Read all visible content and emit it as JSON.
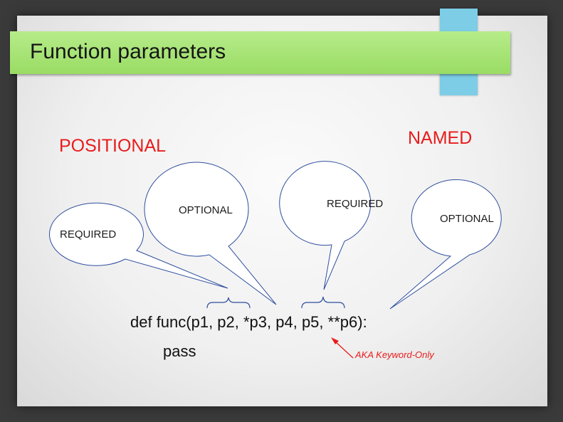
{
  "title": "Function parameters",
  "headings": {
    "positional": "POSITIONAL",
    "named": "NAMED"
  },
  "bubbles": {
    "positional_required": "REQUIRED",
    "positional_optional": "OPTIONAL",
    "named_required": "REQUIRED",
    "named_optional": "OPTIONAL"
  },
  "code": {
    "line1": "def func(p1, p2, *p3, p4, p5, **p6):",
    "line2": "pass"
  },
  "annotation": "AKA Keyword-Only",
  "colors": {
    "title_bar": "#9adc64",
    "accent_tab": "#7dcde7",
    "heading_red": "#e81c1c",
    "bubble_stroke": "#2f4f9e"
  }
}
